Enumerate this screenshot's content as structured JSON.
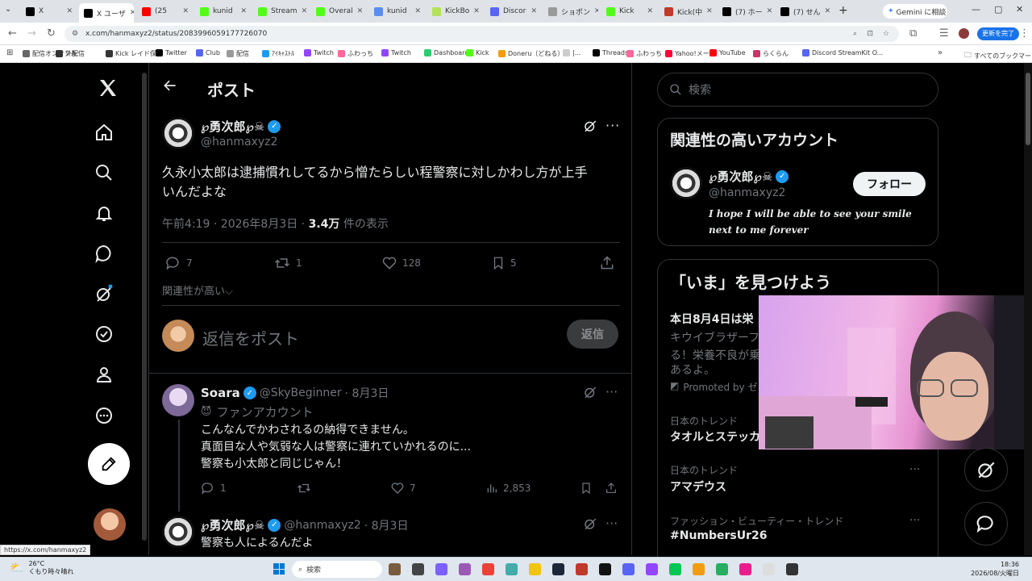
{
  "browser": {
    "tabs": [
      {
        "label": "X",
        "color": "#000000"
      },
      {
        "label": "X ユーザ",
        "color": "#000000"
      },
      {
        "label": "(25",
        "color": "#ff0000"
      },
      {
        "label": "kunid",
        "color": "#53fc18"
      },
      {
        "label": "Stream",
        "color": "#53fc18"
      },
      {
        "label": "Overal",
        "color": "#53fc18"
      },
      {
        "label": "kunid",
        "color": "#5b8def"
      },
      {
        "label": "KickBo",
        "color": "#b4e35a"
      },
      {
        "label": "Discor",
        "color": "#5865f2"
      },
      {
        "label": "ショポン",
        "color": "#999999"
      },
      {
        "label": "Kick",
        "color": "#53fc18"
      },
      {
        "label": "Kick(中",
        "color": "#c0392b"
      },
      {
        "label": "(7) ホー",
        "color": "#000000"
      },
      {
        "label": "(7) せん",
        "color": "#000000"
      }
    ],
    "gemini_label": "Gemini に相談",
    "url": "x.com/hanmaxyz2/status/2083996059177726070",
    "update_label": "更新を完了",
    "bookmarks": [
      {
        "label": "配信オンオフ系",
        "color": "#666666"
      },
      {
        "label": "外配信",
        "color": "#333333"
      },
      {
        "label": "Kick レイド保持",
        "color": "#333333"
      },
      {
        "label": "Twitter",
        "color": "#000000"
      },
      {
        "label": "Club",
        "color": "#5865f2"
      },
      {
        "label": "配信",
        "color": "#999999"
      },
      {
        "label": "ｱｲｷｬｽﾄﾙ",
        "color": "#1d9bf0"
      },
      {
        "label": "Twitch",
        "color": "#9146ff"
      },
      {
        "label": "ふわっち",
        "color": "#ff6699"
      },
      {
        "label": "Twitch",
        "color": "#9146ff"
      },
      {
        "label": "Dashboard",
        "color": "#2ecc71"
      },
      {
        "label": "Kick",
        "color": "#53fc18"
      },
      {
        "label": "Doneru（どねる）",
        "color": "#f39c12"
      },
      {
        "label": "|...",
        "color": "#cccccc"
      },
      {
        "label": "Threads",
        "color": "#000000"
      },
      {
        "label": "ふわっち",
        "color": "#ff6699"
      },
      {
        "label": "Yahoo!メール",
        "color": "#ff0033"
      },
      {
        "label": "YouTube",
        "color": "#ff0000"
      },
      {
        "label": "らくらん",
        "color": "#cc3366"
      },
      {
        "label": "Discord StreamKit O...",
        "color": "#5865f2"
      }
    ],
    "all_bookmarks_label": "すべてのブックマーク",
    "status_url": "https://x.com/hanmaxyz2"
  },
  "page": {
    "header_title": "ポスト",
    "post": {
      "name": "℘勇次郎℘☠",
      "handle": "@hanmaxyz2",
      "text_line1": "久永小太郎は逮捕慣れしてるから憎たらしい程警察に対しかわし方が上手",
      "text_line2": "いんだよな",
      "time": "午前4:19 · 2026年8月3日 · ",
      "views_count": "3.4万",
      "views_label": " 件の表示",
      "replies": "7",
      "reposts": "1",
      "likes": "128",
      "bookmarks": "5",
      "sort_label": "関連性が高い⌵"
    },
    "reply_box": {
      "placeholder": "返信をポスト",
      "button": "返信"
    },
    "replies": [
      {
        "name": "Soara",
        "handle": "@SkyBeginner",
        "date": " · 8月3日",
        "tag": "ファンアカウント",
        "lines": [
          "こんなんでかわされるの納得できません。",
          "真面目な人や気弱な人は警察に連れていかれるのに...",
          "警察も小太郎と同じじゃん！"
        ],
        "replies": "1",
        "reposts": "",
        "likes": "7",
        "views": "2,853"
      },
      {
        "name": "℘勇次郎℘☠",
        "handle": "@hanmaxyz2",
        "date": " · 8月3日",
        "line1": "警察も人によるんだよ"
      }
    ]
  },
  "sidebar": {
    "search_placeholder": "検索",
    "related_title": "関連性の高いアカウント",
    "account": {
      "name": "℘勇次郎℘☠",
      "handle": "@hanmaxyz2",
      "follow": "フォロー",
      "bio_line1": "I hope I will be able to see your smile",
      "bio_line2": "next to me forever"
    },
    "now_title": "「いま」を見つけよう",
    "promo": {
      "title": "本日8月4日は栄",
      "line1": "キウイブラザーフ",
      "line2": "る！栄養不良が乗",
      "line3": "あるよ。",
      "promoted": "Promoted by ゼ"
    },
    "trends": [
      {
        "category": "日本のトレンド",
        "name": "タオルとステッカ"
      },
      {
        "category": "日本のトレンド",
        "name": "アマデウス"
      },
      {
        "category": "ファッション・ビューティー・トレンド",
        "name": "#NumbersUr26"
      }
    ]
  },
  "taskbar": {
    "weather_temp": "26°C",
    "weather_text": "くもり時々晴れ",
    "search_label": "検索",
    "time": "18:36",
    "date": "2026/08/火曜日"
  }
}
